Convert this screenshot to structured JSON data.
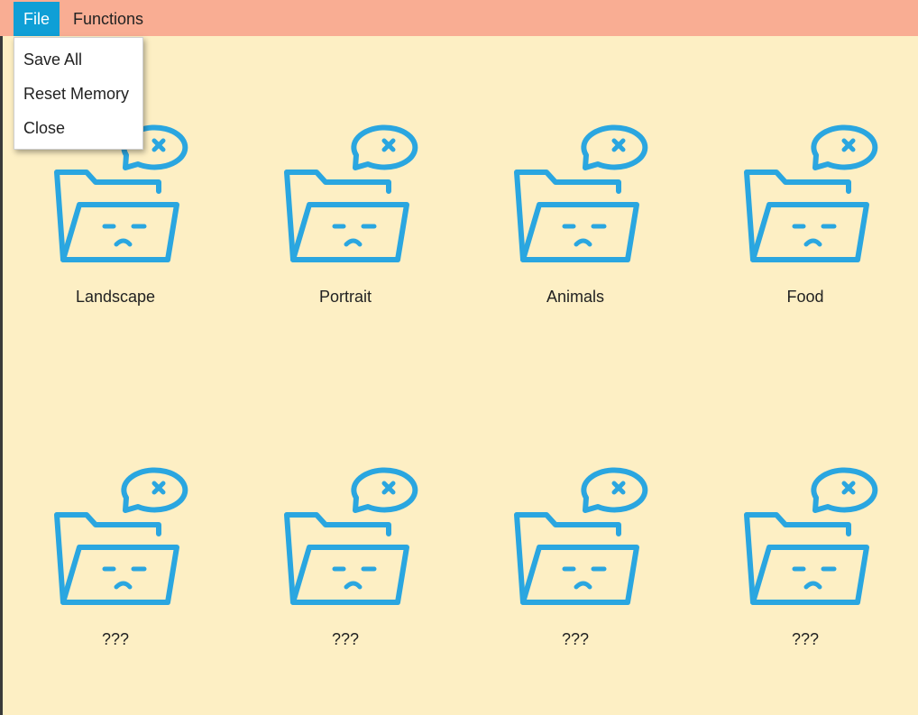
{
  "menubar": {
    "file_label": "File",
    "functions_label": "Functions"
  },
  "file_menu": {
    "items": [
      {
        "label": "Save All"
      },
      {
        "label": "Reset Memory"
      },
      {
        "label": "Close"
      }
    ]
  },
  "folders": [
    {
      "label": "Landscape",
      "icon": "sad-folder-icon"
    },
    {
      "label": "Portrait",
      "icon": "sad-folder-icon"
    },
    {
      "label": "Animals",
      "icon": "sad-folder-icon"
    },
    {
      "label": "Food",
      "icon": "sad-folder-icon"
    },
    {
      "label": "???",
      "icon": "sad-folder-icon"
    },
    {
      "label": "???",
      "icon": "sad-folder-icon"
    },
    {
      "label": "???",
      "icon": "sad-folder-icon"
    },
    {
      "label": "???",
      "icon": "sad-folder-icon"
    }
  ],
  "colors": {
    "background": "#fdefc4",
    "menubar": "#f9ad93",
    "menu_active": "#0f9fd6",
    "icon_stroke": "#2aa6e0"
  }
}
